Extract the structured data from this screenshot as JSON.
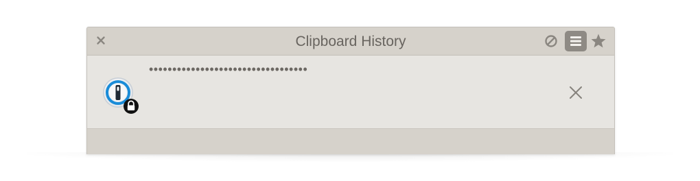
{
  "window": {
    "title": "Clipboard History"
  },
  "toolbar": {
    "close_icon": "close-icon",
    "block_icon": "no-entry-icon",
    "list_icon": "list-icon",
    "star_icon": "star-icon",
    "list_active": true
  },
  "clip_item": {
    "text": "••••••••••••••••••••••••••••••••••",
    "app_icon": "1password-app-icon",
    "badge_icon": "lock-icon",
    "remove_icon": "remove-icon"
  },
  "colors": {
    "titlebar_bg": "#d6d2cb",
    "row_bg": "#e7e5e1",
    "text": "#68645f",
    "accent_blue": "#1a8cd8",
    "active_button_bg": "#8e8a84"
  }
}
